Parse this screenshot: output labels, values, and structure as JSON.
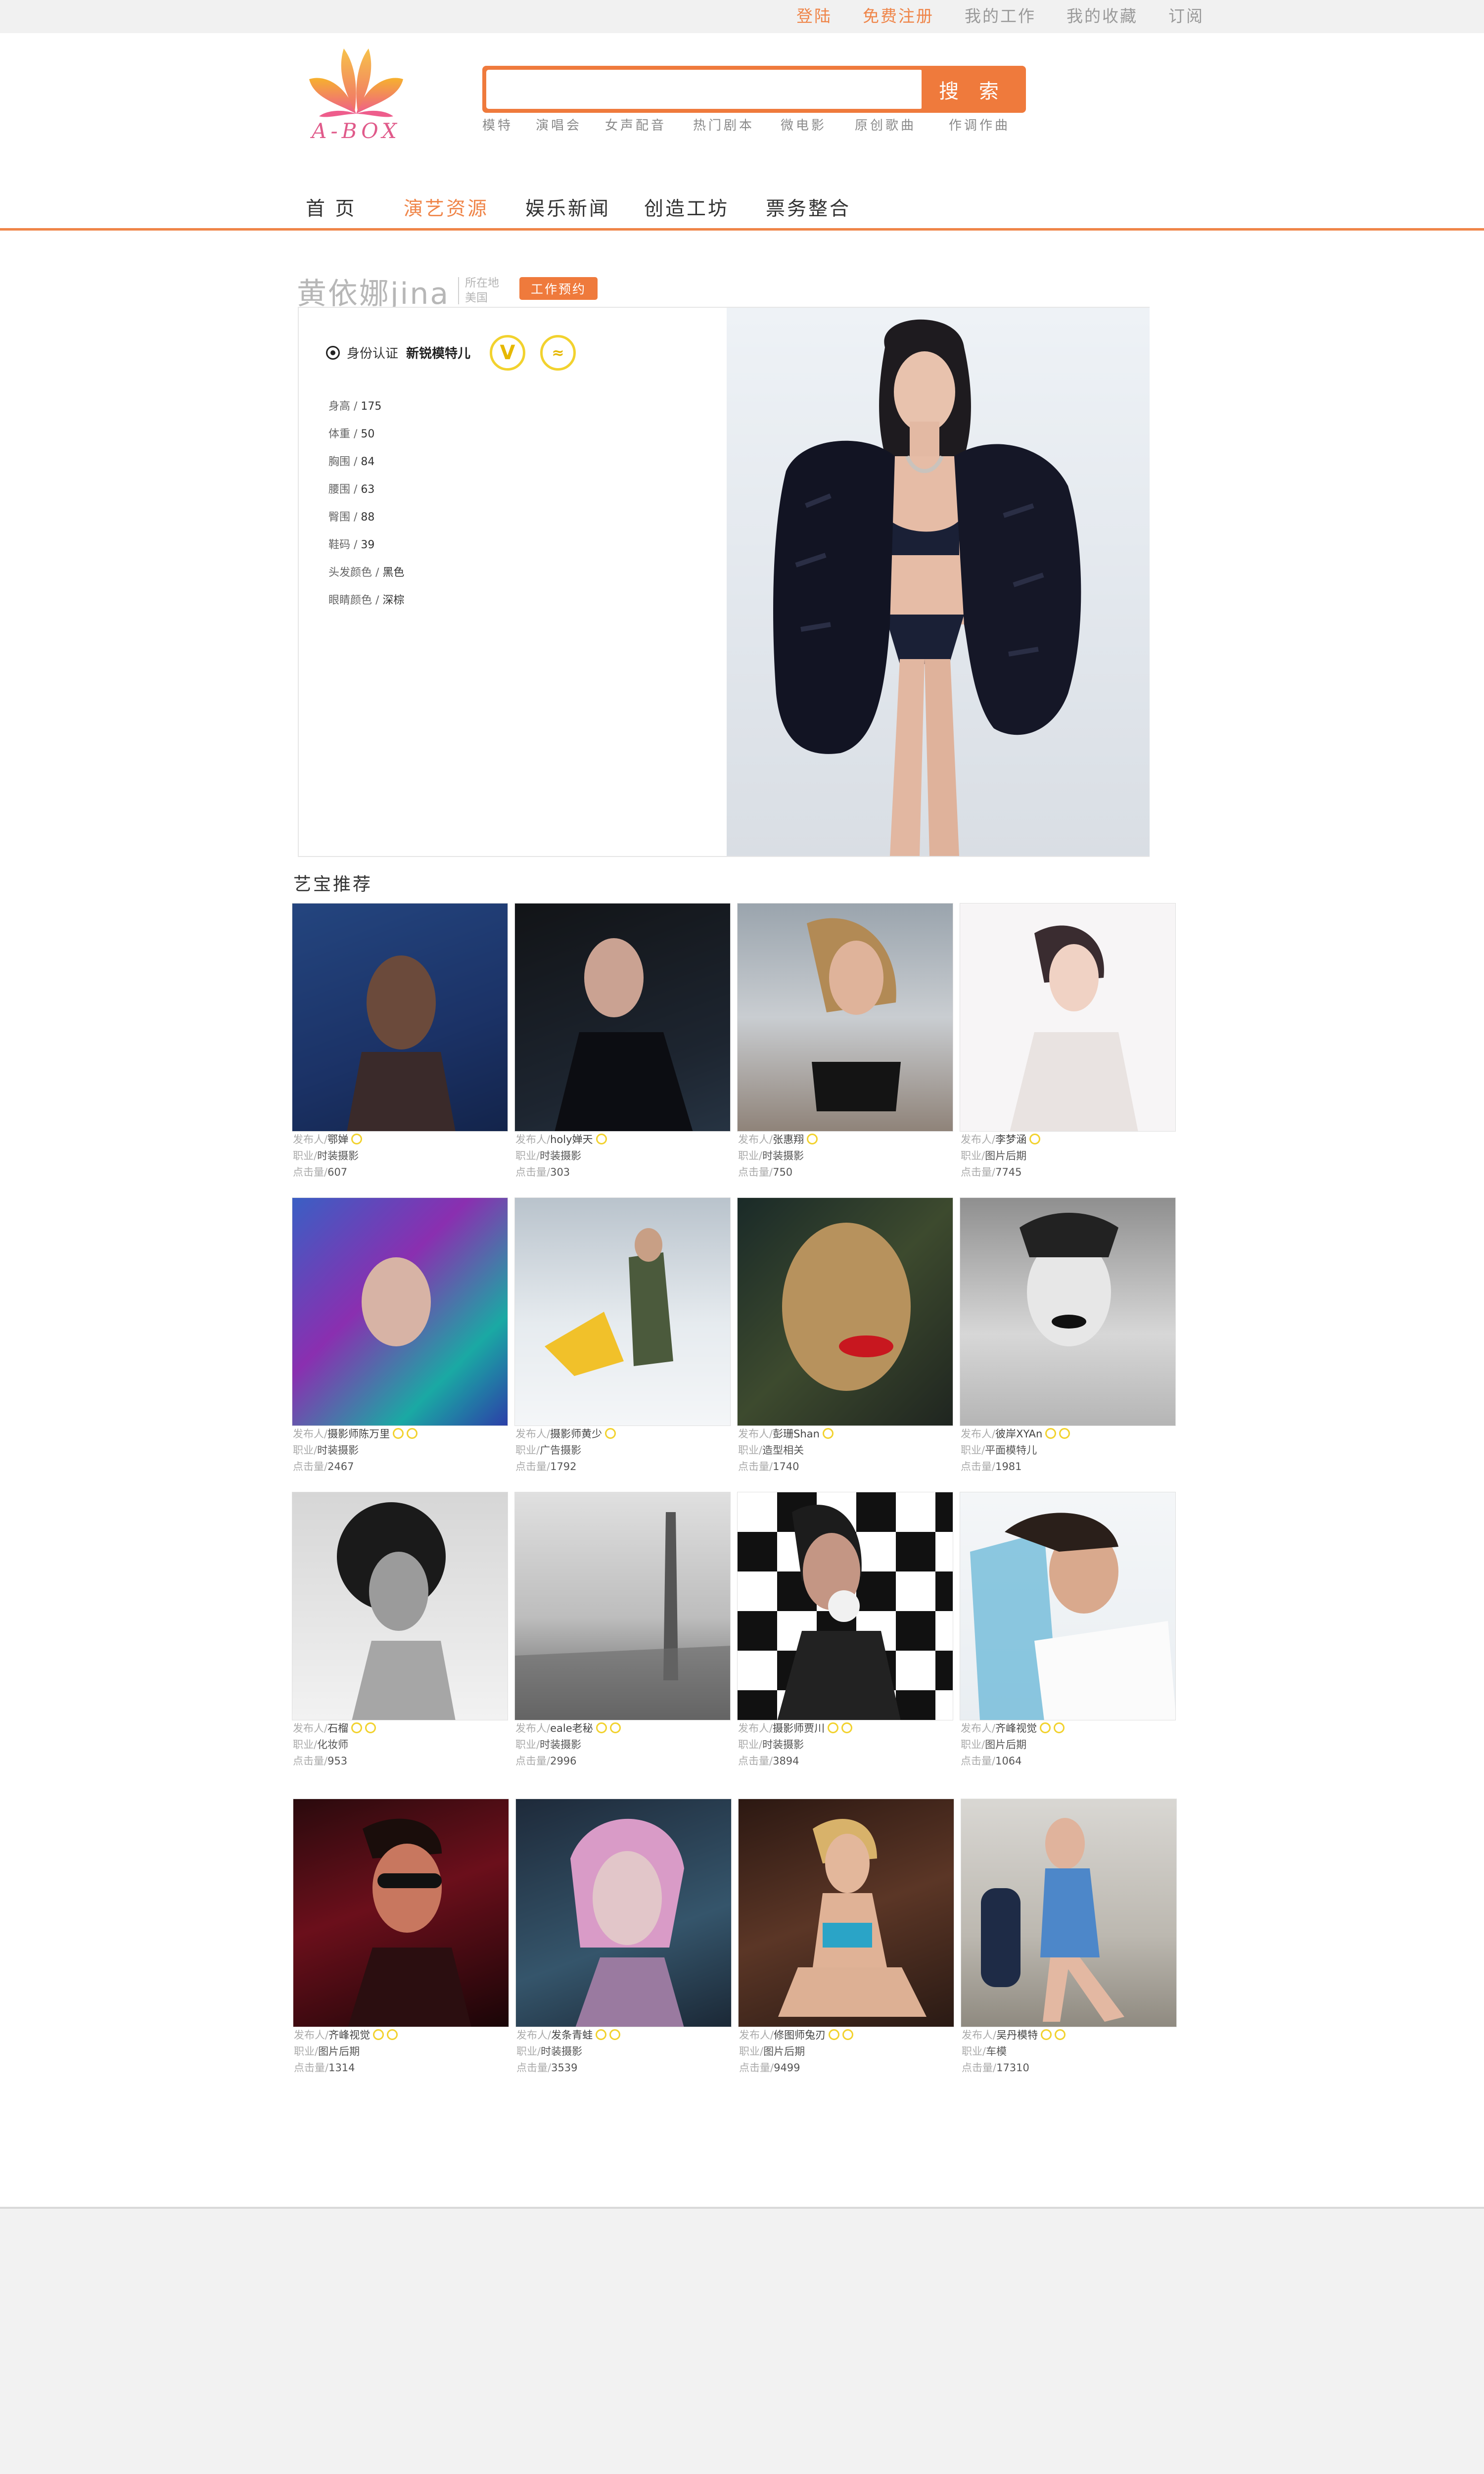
{
  "topbar": {
    "links": [
      {
        "label": "登陆"
      },
      {
        "label": "免费注册"
      },
      {
        "label": "我的工作"
      },
      {
        "label": "我的收藏"
      },
      {
        "label": "订阅"
      }
    ]
  },
  "logo": {
    "word": "A-BOX"
  },
  "search": {
    "value": "",
    "button_label": "搜 索",
    "hotwords": [
      "模特",
      "演唱会",
      "女声配音",
      "热门剧本",
      "微电影",
      "原创歌曲",
      "作调作曲"
    ]
  },
  "nav": {
    "items": [
      {
        "label": "首  页"
      },
      {
        "label": "演艺资源"
      },
      {
        "label": "娱乐新闻"
      },
      {
        "label": "创造工坊"
      },
      {
        "label": "票务整合"
      }
    ],
    "active_index": 1
  },
  "profile": {
    "name": "黄依娜jina",
    "location_label": "所在地",
    "location": "美国",
    "book_button": "工作预约",
    "cert_label": "身份认证",
    "cert_badge": "新锐模特儿",
    "stats": [
      {
        "label": "身高",
        "value": "175"
      },
      {
        "label": "体重",
        "value": "50"
      },
      {
        "label": "胸围",
        "value": "84"
      },
      {
        "label": "腰围",
        "value": "63"
      },
      {
        "label": "臀围",
        "value": "88"
      },
      {
        "label": "鞋码",
        "value": "39"
      },
      {
        "label": "头发颜色",
        "value": "黑色"
      },
      {
        "label": "眼睛颜色",
        "value": "深棕"
      }
    ]
  },
  "recommend": {
    "title": "艺宝推荐",
    "publisher_label": "发布人/",
    "job_label": "职业/",
    "clicks_label": "点击量/",
    "items": [
      {
        "publisher": "鄂婵",
        "job": "时装摄影",
        "clicks": "607"
      },
      {
        "publisher": "holy婵天",
        "job": "时装摄影",
        "clicks": "303"
      },
      {
        "publisher": "张惠翔",
        "job": "时装摄影",
        "clicks": "750"
      },
      {
        "publisher": "李梦涵",
        "job": "图片后期",
        "clicks": "7745"
      },
      {
        "publisher": "摄影师陈万里",
        "job": "时装摄影",
        "clicks": "2467"
      },
      {
        "publisher": "摄影师黄少",
        "job": "广告摄影",
        "clicks": "1792"
      },
      {
        "publisher": "彭珊Shan",
        "job": "造型相关",
        "clicks": "1740"
      },
      {
        "publisher": "彼岸XYAn",
        "job": "平面模特儿",
        "clicks": "1981"
      },
      {
        "publisher": "石榴",
        "job": "化妆师",
        "clicks": "953"
      },
      {
        "publisher": "eale老秘",
        "job": "时装摄影",
        "clicks": "2996"
      },
      {
        "publisher": "摄影师贾川",
        "job": "时装摄影",
        "clicks": "3894"
      },
      {
        "publisher": "齐峰视觉",
        "job": "图片后期",
        "clicks": "1064"
      },
      {
        "publisher": "齐峰视觉",
        "job": "图片后期",
        "clicks": "1314"
      },
      {
        "publisher": "发条青蛙",
        "job": "时装摄影",
        "clicks": "3539"
      },
      {
        "publisher": "修图师兔刃",
        "job": "图片后期",
        "clicks": "9499"
      },
      {
        "publisher": "吴丹模特",
        "job": "车模",
        "clicks": "17310"
      }
    ]
  },
  "colors": {
    "accent": "#ef7a3c",
    "nav_active": "#ef8549",
    "badge": "#f2d22e"
  }
}
